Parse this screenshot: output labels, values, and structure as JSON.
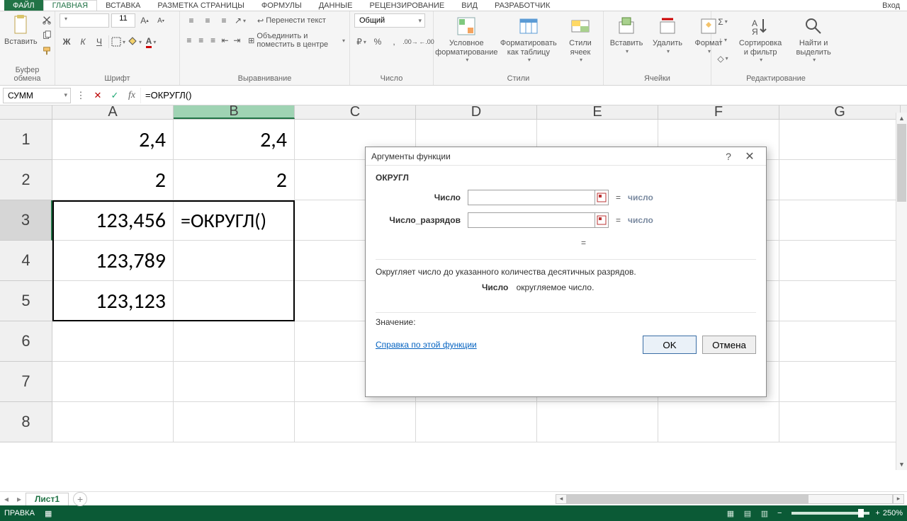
{
  "tabs": {
    "file": "ФАЙЛ",
    "home": "ГЛАВНАЯ",
    "insert": "ВСТАВКА",
    "layout": "РАЗМЕТКА СТРАНИЦЫ",
    "formulas": "ФОРМУЛЫ",
    "data": "ДАННЫЕ",
    "review": "РЕЦЕНЗИРОВАНИЕ",
    "view": "ВИД",
    "developer": "РАЗРАБОТЧИК",
    "login": "Вход"
  },
  "ribbon": {
    "clipboard": {
      "paste": "Вставить",
      "label": "Буфер обмена"
    },
    "font": {
      "size": "11",
      "bold": "Ж",
      "italic": "К",
      "underline": "Ч",
      "label": "Шрифт"
    },
    "align": {
      "wrap": "Перенести текст",
      "merge": "Объединить и поместить в центре",
      "label": "Выравнивание"
    },
    "number": {
      "format": "Общий",
      "label": "Число"
    },
    "styles": {
      "cond": "Условное форматирование",
      "table": "Форматировать как таблицу",
      "cell": "Стили ячеек",
      "label": "Стили"
    },
    "cells": {
      "insert": "Вставить",
      "delete": "Удалить",
      "format": "Формат",
      "label": "Ячейки"
    },
    "editing": {
      "sort": "Сортировка и фильтр",
      "find": "Найти и выделить",
      "label": "Редактирование"
    }
  },
  "formula_bar": {
    "name_box": "СУММ",
    "formula": "=ОКРУГЛ()"
  },
  "columns": [
    "A",
    "B",
    "C",
    "D",
    "E",
    "F",
    "G"
  ],
  "rows": [
    "1",
    "2",
    "3",
    "4",
    "5",
    "6",
    "7",
    "8"
  ],
  "cells": {
    "A1": "2,4",
    "B1": "2,4",
    "A2": "2",
    "B2": "2",
    "A3": "123,456",
    "B3": "=ОКРУГЛ()",
    "A4": "123,789",
    "A5": "123,123"
  },
  "dialog": {
    "title": "Аргументы функции",
    "fn": "ОКРУГЛ",
    "arg1_label": "Число",
    "arg2_label": "Число_разрядов",
    "hint": "число",
    "eq": "=",
    "desc": "Округляет число до указанного количества десятичных разрядов.",
    "arg_name": "Число",
    "arg_desc": "округляемое число.",
    "value_label": "Значение:",
    "help": "Справка по этой функции",
    "ok": "OK",
    "cancel": "Отмена"
  },
  "sheet_tabs": {
    "sheet1": "Лист1"
  },
  "status": {
    "mode": "ПРАВКА",
    "zoom": "250%"
  }
}
